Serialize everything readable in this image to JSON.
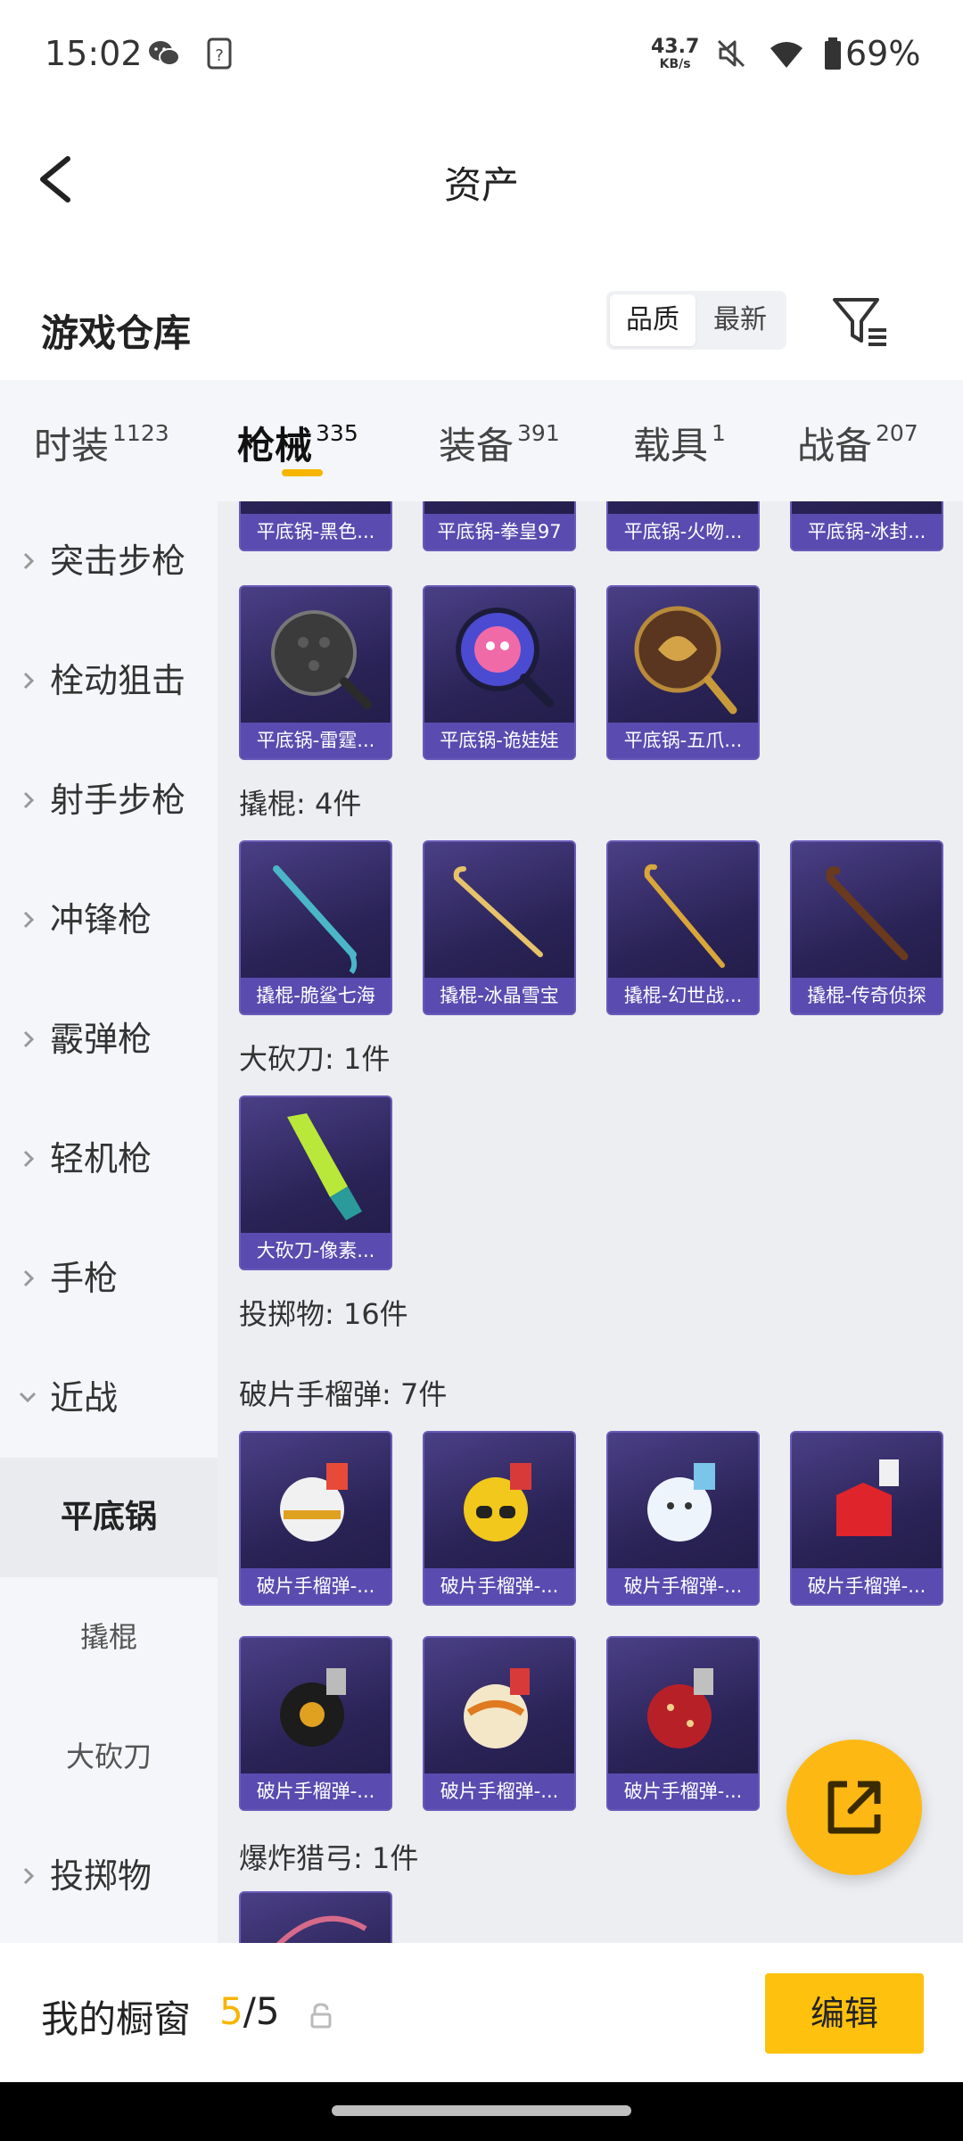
{
  "status_bar": {
    "time": "15:02",
    "net_speed_value": "43.7",
    "net_speed_unit": "KB/s",
    "battery": "69%",
    "icons": [
      "wechat-icon",
      "unknown-app-icon",
      "mute-icon",
      "wifi-icon",
      "battery-icon"
    ]
  },
  "header": {
    "title": "资产"
  },
  "section": {
    "title": "游戏仓库",
    "sort_options": [
      "品质",
      "最新"
    ],
    "active_sort": "品质"
  },
  "tabs": [
    {
      "label": "时装",
      "count": "1123"
    },
    {
      "label": "枪械",
      "count": "335"
    },
    {
      "label": "装备",
      "count": "391"
    },
    {
      "label": "载具",
      "count": "1"
    },
    {
      "label": "战备",
      "count": "207"
    }
  ],
  "active_tab": "枪械",
  "sidebar": {
    "categories": [
      "突击步枪",
      "栓动狙击",
      "射手步枪",
      "冲锋枪",
      "霰弹枪",
      "轻机枪",
      "手枪",
      "近战"
    ],
    "melee_sub": [
      "平底锅",
      "撬棍",
      "大砍刀"
    ],
    "active_sub": "平底锅",
    "after": "投掷物"
  },
  "content": {
    "top_row": [
      "平底锅-黑色...",
      "平底锅-拳皇97",
      "平底锅-火吻...",
      "平底锅-冰封..."
    ],
    "pan_row2": [
      "平底锅-雷霆...",
      "平底锅-诡娃娃",
      "平底锅-五爪..."
    ],
    "crowbar_label": "撬棍: 4件",
    "crowbar": [
      "撬棍-脆鲨七海",
      "撬棍-冰晶雪宝",
      "撬棍-幻世战...",
      "撬棍-传奇侦探"
    ],
    "machete_label": "大砍刀: 1件",
    "machete": [
      "大砍刀-像素..."
    ],
    "throwable_label": "投掷物: 16件",
    "frag_label": "破片手榴弹: 7件",
    "frag_row1": [
      "破片手榴弹-...",
      "破片手榴弹-...",
      "破片手榴弹-...",
      "破片手榴弹-..."
    ],
    "frag_row2": [
      "破片手榴弹-...",
      "破片手榴弹-...",
      "破片手榴弹-..."
    ],
    "bow_label": "爆炸猎弓: 1件"
  },
  "bottom": {
    "showcase_label": "我的橱窗",
    "showcase_used": "5",
    "showcase_sep": "/",
    "showcase_total": "5",
    "edit_label": "编辑"
  },
  "colors": {
    "accent": "#f7b500",
    "card_bg": "#2a2356",
    "card_caption": "#5a4bb0"
  }
}
